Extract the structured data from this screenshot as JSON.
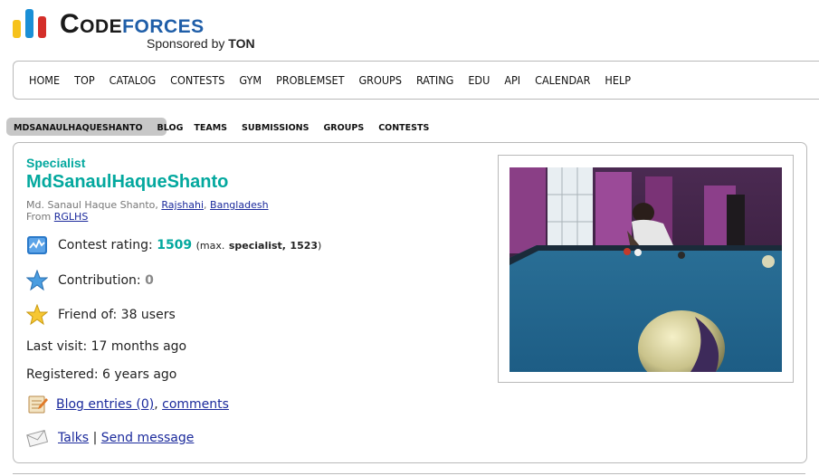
{
  "logo": {
    "text_part1": "Code",
    "text_part2": "forces",
    "sponsor_prefix": "Sponsored by ",
    "sponsor_name": "TON",
    "colors": {
      "yellow": "#f6c21c",
      "blue": "#1a8fd6",
      "red": "#d42f2a"
    }
  },
  "main_nav": [
    "HOME",
    "TOP",
    "CATALOG",
    "CONTESTS",
    "GYM",
    "PROBLEMSET",
    "GROUPS",
    "RATING",
    "EDU",
    "API",
    "CALENDAR",
    "HELP"
  ],
  "sub_nav": [
    "MDSANAULHAQUESHANTO",
    "BLOG",
    "TEAMS",
    "SUBMISSIONS",
    "GROUPS",
    "CONTESTS"
  ],
  "profile": {
    "rank": "Specialist",
    "handle": "MdSanaulHaqueShanto",
    "full_name": "Md. Sanaul Haque Shanto",
    "city": "Rajshahi",
    "country": "Bangladesh",
    "from_label": "From",
    "organization": "RGLHS",
    "rating_label": "Contest rating:",
    "rating_value": "1509",
    "max_prefix": "(max.",
    "max_rank": "specialist,",
    "max_value": "1523",
    "max_suffix": ")",
    "contribution_label": "Contribution:",
    "contribution_value": "0",
    "friend_label": "Friend of: 38 users",
    "last_visit": "Last visit: 17 months ago",
    "registered": "Registered: 6 years ago",
    "blog_entries": "Blog entries (0)",
    "comments": "comments",
    "talks": "Talks",
    "separator": "|",
    "send_message": "Send message",
    "accent_color": "#03a89e"
  },
  "icons": [
    "rating-chart-icon",
    "star-blue-icon",
    "star-gold-icon",
    "blog-icon",
    "envelope-icon"
  ]
}
